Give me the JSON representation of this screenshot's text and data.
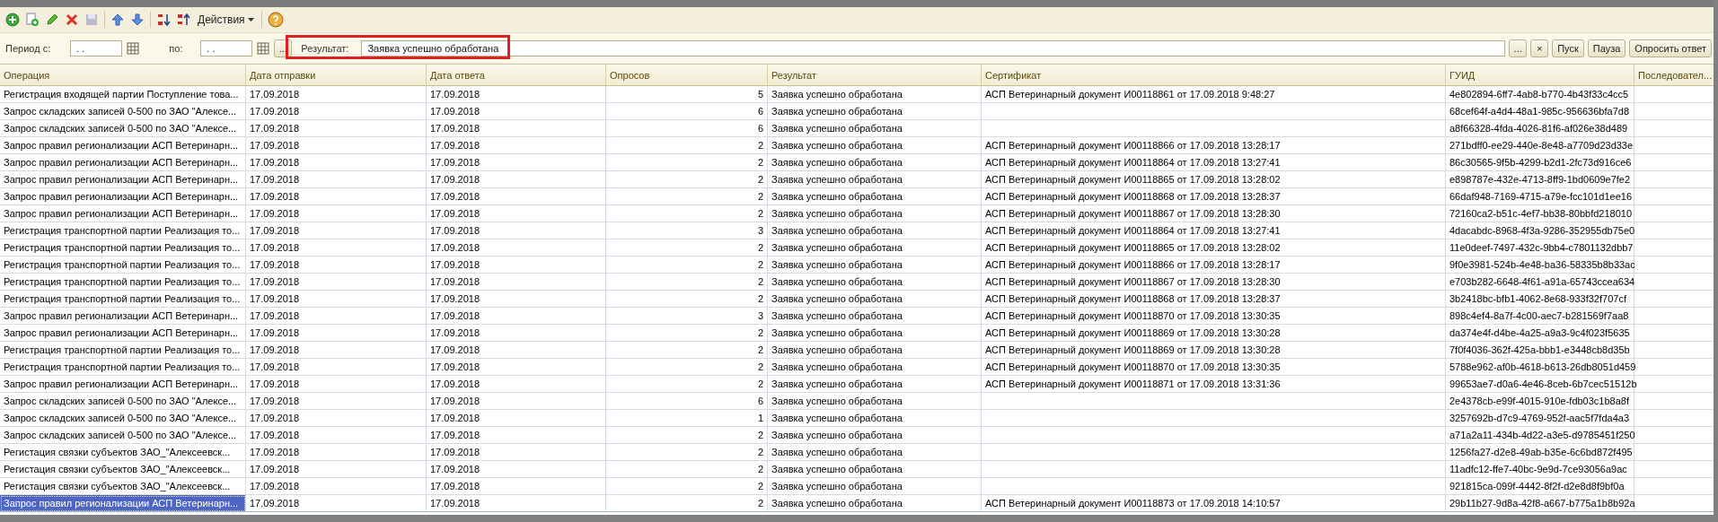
{
  "toolbar": {
    "actions_menu": "Действия"
  },
  "filter": {
    "period_from_label": "Период с:",
    "period_from_value": ". .",
    "period_to_label": "по:",
    "period_to_value": ". .",
    "period_select_button": "...",
    "result_label": "Результат:",
    "result_value": "Заявка успешно обработана",
    "result_highlighted": true,
    "result_select_button": "...",
    "result_clear_button": "×",
    "buttons": [
      "Пуск",
      "Пауза",
      "Опросить ответ"
    ]
  },
  "table": {
    "columns": [
      {
        "title": "Операция",
        "kind": "text"
      },
      {
        "title": "Дата отправки",
        "kind": "text"
      },
      {
        "title": "Дата ответа",
        "kind": "text"
      },
      {
        "title": "Опросов",
        "kind": "number"
      },
      {
        "title": "Результат",
        "kind": "text"
      },
      {
        "title": "Сертификат",
        "kind": "text"
      },
      {
        "title": "ГУИД",
        "kind": "text"
      },
      {
        "title": "Последовател...",
        "kind": "text"
      }
    ],
    "rows": [
      {
        "selected": false,
        "cells": [
          "Регистрация входящей партии Поступление това...",
          "17.09.2018",
          "17.09.2018",
          "5",
          "Заявка успешно обработана",
          "АСП Ветеринарный документ И00118861 от 17.09.2018 9:48:27",
          "4e802894-6ff7-4ab8-b770-4b43f33c4cc5",
          ""
        ]
      },
      {
        "selected": false,
        "cells": [
          "Запрос складских записей 0-500 по ЗАО \"Алексе...",
          "17.09.2018",
          "17.09.2018",
          "6",
          "Заявка успешно обработана",
          "",
          "68cef64f-a4d4-48a1-985c-956636bfa7d8",
          ""
        ]
      },
      {
        "selected": false,
        "cells": [
          "Запрос складских записей 0-500 по ЗАО \"Алексе...",
          "17.09.2018",
          "17.09.2018",
          "6",
          "Заявка успешно обработана",
          "",
          "a8f66328-4fda-4026-81f6-af026e38d489",
          ""
        ]
      },
      {
        "selected": false,
        "cells": [
          "Запрос правил регионализации АСП Ветеринарн...",
          "17.09.2018",
          "17.09.2018",
          "2",
          "Заявка успешно обработана",
          "АСП Ветеринарный документ И00118866 от 17.09.2018 13:28:17",
          "271bdff0-ee29-440e-8e48-a7709d23d33e",
          ""
        ]
      },
      {
        "selected": false,
        "cells": [
          "Запрос правил регионализации АСП Ветеринарн...",
          "17.09.2018",
          "17.09.2018",
          "2",
          "Заявка успешно обработана",
          "АСП Ветеринарный документ И00118864 от 17.09.2018 13:27:41",
          "86c30565-9f5b-4299-b2d1-2fc73d916ce6",
          ""
        ]
      },
      {
        "selected": false,
        "cells": [
          "Запрос правил регионализации АСП Ветеринарн...",
          "17.09.2018",
          "17.09.2018",
          "2",
          "Заявка успешно обработана",
          "АСП Ветеринарный документ И00118865 от 17.09.2018 13:28:02",
          "e898787e-432e-4713-8ff9-1bd0609e7fe2",
          ""
        ]
      },
      {
        "selected": false,
        "cells": [
          "Запрос правил регионализации АСП Ветеринарн...",
          "17.09.2018",
          "17.09.2018",
          "2",
          "Заявка успешно обработана",
          "АСП Ветеринарный документ И00118868 от 17.09.2018 13:28:37",
          "66daf948-7169-4715-a79e-fcc101d1ee16",
          ""
        ]
      },
      {
        "selected": false,
        "cells": [
          "Запрос правил регионализации АСП Ветеринарн...",
          "17.09.2018",
          "17.09.2018",
          "2",
          "Заявка успешно обработана",
          "АСП Ветеринарный документ И00118867 от 17.09.2018 13:28:30",
          "72160ca2-b51c-4ef7-bb38-80bbfd218010",
          ""
        ]
      },
      {
        "selected": false,
        "cells": [
          "Регистрация транспортной партии Реализация то...",
          "17.09.2018",
          "17.09.2018",
          "3",
          "Заявка успешно обработана",
          "АСП Ветеринарный документ И00118864 от 17.09.2018 13:27:41",
          "4dacabdc-8968-4f3a-9286-352955db75e0",
          ""
        ]
      },
      {
        "selected": false,
        "cells": [
          "Регистрация транспортной партии Реализация то...",
          "17.09.2018",
          "17.09.2018",
          "2",
          "Заявка успешно обработана",
          "АСП Ветеринарный документ И00118865 от 17.09.2018 13:28:02",
          "11e0deef-7497-432c-9bb4-c7801132dbb7",
          ""
        ]
      },
      {
        "selected": false,
        "cells": [
          "Регистрация транспортной партии Реализация то...",
          "17.09.2018",
          "17.09.2018",
          "2",
          "Заявка успешно обработана",
          "АСП Ветеринарный документ И00118866 от 17.09.2018 13:28:17",
          "9f0e3981-524b-4e48-ba36-58335b8b33ac",
          ""
        ]
      },
      {
        "selected": false,
        "cells": [
          "Регистрация транспортной партии Реализация то...",
          "17.09.2018",
          "17.09.2018",
          "2",
          "Заявка успешно обработана",
          "АСП Ветеринарный документ И00118867 от 17.09.2018 13:28:30",
          "e703b282-6648-4f61-a91a-65743ccea634",
          ""
        ]
      },
      {
        "selected": false,
        "cells": [
          "Регистрация транспортной партии Реализация то...",
          "17.09.2018",
          "17.09.2018",
          "2",
          "Заявка успешно обработана",
          "АСП Ветеринарный документ И00118868 от 17.09.2018 13:28:37",
          "3b2418bc-bfb1-4062-8e68-933f32f707cf",
          ""
        ]
      },
      {
        "selected": false,
        "cells": [
          "Запрос правил регионализации АСП Ветеринарн...",
          "17.09.2018",
          "17.09.2018",
          "3",
          "Заявка успешно обработана",
          "АСП Ветеринарный документ И00118870 от 17.09.2018 13:30:35",
          "898c4ef4-8a7f-4c00-aec7-b281569f7aa8",
          ""
        ]
      },
      {
        "selected": false,
        "cells": [
          "Запрос правил регионализации АСП Ветеринарн...",
          "17.09.2018",
          "17.09.2018",
          "2",
          "Заявка успешно обработана",
          "АСП Ветеринарный документ И00118869 от 17.09.2018 13:30:28",
          "da374e4f-d4be-4a25-a9a3-9c4f023f5635",
          ""
        ]
      },
      {
        "selected": false,
        "cells": [
          "Регистрация транспортной партии Реализация то...",
          "17.09.2018",
          "17.09.2018",
          "2",
          "Заявка успешно обработана",
          "АСП Ветеринарный документ И00118869 от 17.09.2018 13:30:28",
          "7f0f4036-362f-425a-bbb1-e3448cb8d35b",
          ""
        ]
      },
      {
        "selected": false,
        "cells": [
          "Регистрация транспортной партии Реализация то...",
          "17.09.2018",
          "17.09.2018",
          "2",
          "Заявка успешно обработана",
          "АСП Ветеринарный документ И00118870 от 17.09.2018 13:30:35",
          "5788e962-af0b-4618-b613-26db8051d459",
          ""
        ]
      },
      {
        "selected": false,
        "cells": [
          "Запрос правил регионализации АСП Ветеринарн...",
          "17.09.2018",
          "17.09.2018",
          "2",
          "Заявка успешно обработана",
          "АСП Ветеринарный документ И00118871 от 17.09.2018 13:31:36",
          "99653ae7-d0a6-4e46-8ceb-6b7cec51512b",
          ""
        ]
      },
      {
        "selected": false,
        "cells": [
          "Запрос складских записей 0-500 по ЗАО \"Алексе...",
          "17.09.2018",
          "17.09.2018",
          "6",
          "Заявка успешно обработана",
          "",
          "2e4378cb-e99f-4015-910e-fdb03c1b8a8f",
          ""
        ]
      },
      {
        "selected": false,
        "cells": [
          "Запрос складских записей 0-500 по ЗАО \"Алексе...",
          "17.09.2018",
          "17.09.2018",
          "1",
          "Заявка успешно обработана",
          "",
          "3257692b-d7c9-4769-952f-aac5f7fda4a3",
          ""
        ]
      },
      {
        "selected": false,
        "cells": [
          "Запрос складских записей 0-500 по ЗАО \"Алексе...",
          "17.09.2018",
          "17.09.2018",
          "2",
          "Заявка успешно обработана",
          "",
          "a71a2a11-434b-4d22-a3e5-d9785451f250",
          ""
        ]
      },
      {
        "selected": false,
        "cells": [
          "Регистация связки субъектов ЗАО_\"Алексеевск...",
          "17.09.2018",
          "17.09.2018",
          "2",
          "Заявка успешно обработана",
          "",
          "1256fa27-d2e8-49ab-b35e-6c6bd872f495",
          ""
        ]
      },
      {
        "selected": false,
        "cells": [
          "Регистация связки субъектов ЗАО_\"Алексеевск...",
          "17.09.2018",
          "17.09.2018",
          "2",
          "Заявка успешно обработана",
          "",
          "11adfc12-ffe7-40bc-9e9d-7ce93056a9ac",
          ""
        ]
      },
      {
        "selected": false,
        "cells": [
          "Регистация связки субъектов ЗАО_\"Алексеевск...",
          "17.09.2018",
          "17.09.2018",
          "2",
          "Заявка успешно обработана",
          "",
          "921815ca-099f-4442-8f2f-d2e8d8f9bf0a",
          ""
        ]
      },
      {
        "selected": true,
        "cells": [
          "Запрос правил регионализации АСП Ветеринарн...",
          "17.09.2018",
          "17.09.2018",
          "2",
          "Заявка успешно обработана",
          "АСП Ветеринарный документ И00118873 от 17.09.2018 14:10:57",
          "29b11b27-9d8a-42f8-a667-b775a1b8b92a",
          ""
        ]
      }
    ]
  }
}
